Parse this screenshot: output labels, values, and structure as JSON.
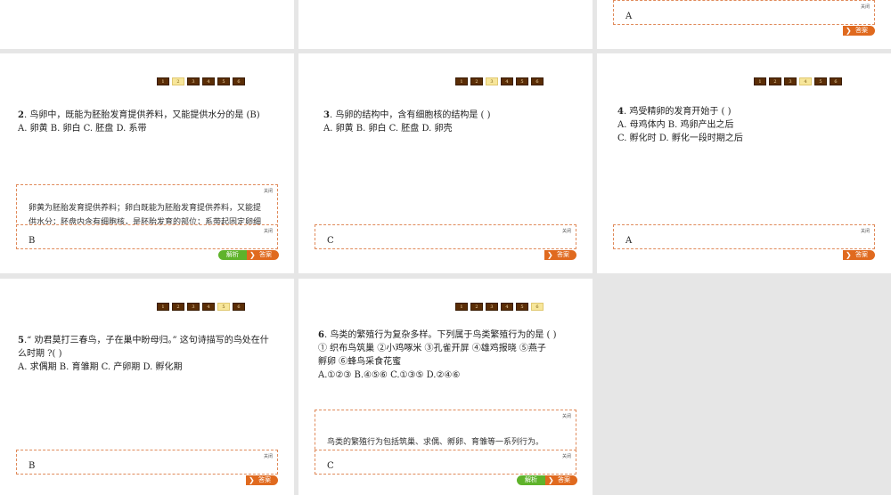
{
  "common": {
    "close": "关闭",
    "answer_btn": "答案",
    "analysis_btn": "解析",
    "chev": "❯"
  },
  "top": {
    "answer_right": "A"
  },
  "nav_pages": [
    "1",
    "2",
    "3",
    "4",
    "5",
    "6"
  ],
  "q2": {
    "num": "2",
    "stem": ". 鸟卵中，既能为胚胎发育提供养料，又能提供水分的是 (B)",
    "options": "A. 卵黄  B. 卵白      C. 胚盘   D. 系带",
    "explanation": "卵黄为胚胎发育提供养料；卵白既能为胚胎发育提供养料，又能提供水分；胚盘内含有细胞核，是胚胎发育的部位；系带起固定卵细胞的作用。",
    "answer": "B"
  },
  "q3": {
    "num": "3",
    "stem": ". 鸟卵的结构中，含有细胞核的结构是 (   )",
    "options": "A. 卵黄  B. 卵白      C. 胚盘   D. 卵壳",
    "answer": "C"
  },
  "q4": {
    "num": "4",
    "stem": ". 鸡受精卵的发育开始于 (  )",
    "options1": "A. 母鸡体内     B. 鸡卵产出之后",
    "options2": "C. 孵化时        D. 孵化一段时期之后",
    "answer": "A"
  },
  "q5": {
    "num": "5",
    "stem": ".“ 劝君莫打三春鸟，子在巢中盼母归。” 这句诗描写的鸟处在什么时期 ?(  )",
    "options": "A. 求偶期        B. 育雏期   C. 产卵期   D. 孵化期",
    "answer": "B"
  },
  "q6": {
    "num": "6",
    "stem": ". 鸟类的繁殖行为复杂多样。下列属于鸟类繁殖行为的是 (   )",
    "items1": "① 织布鸟筑巢   ②小鸡啄米   ③孔雀开屏   ④雄鸡报晓   ⑤燕子",
    "items2": "孵卵   ⑥蜂鸟采食花蜜",
    "options": "A.①②③          B.④⑤⑥    C.①③⑤    D.②④⑥",
    "explanation": "鸟类的繁殖行为包括筑巢、求偶、孵卵、育雏等一系列行为。",
    "answer": "C"
  }
}
